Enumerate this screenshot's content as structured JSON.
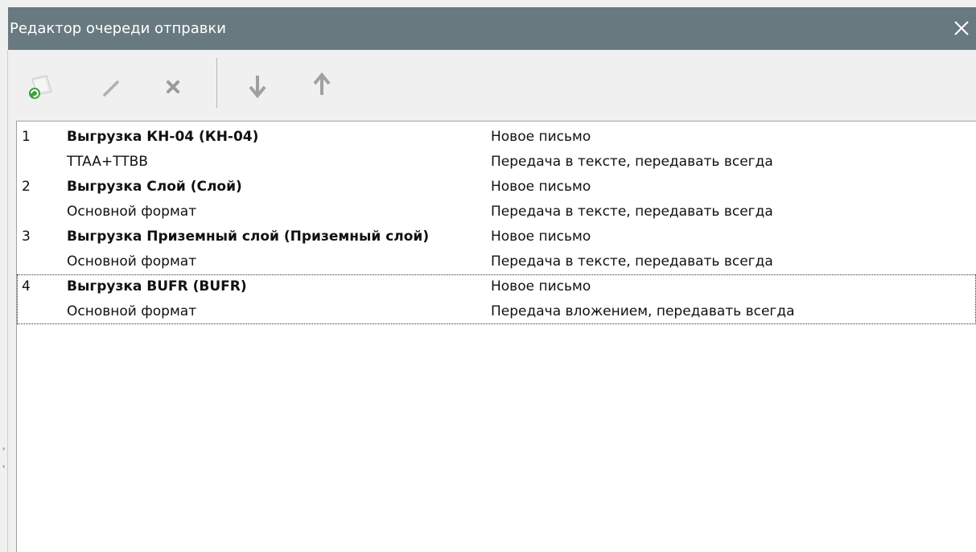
{
  "window": {
    "title": "Редактор очереди отправки",
    "titlebar_color": "#687a80"
  },
  "toolbar": {
    "buttons": [
      {
        "name": "add-button",
        "icon": "add-document-icon",
        "label": ""
      },
      {
        "name": "edit-button",
        "icon": "pencil-icon",
        "label": ""
      },
      {
        "name": "delete-button",
        "icon": "x-icon",
        "label": ""
      },
      {
        "name": "move-down-button",
        "icon": "arrow-down-icon",
        "label": ""
      },
      {
        "name": "move-up-button",
        "icon": "arrow-up-icon",
        "label": ""
      }
    ]
  },
  "queue": {
    "items": [
      {
        "num": "1",
        "name": "Выгрузка КН-04 (КН-04)",
        "format": "TTAA+TTBB",
        "letter": "Новое письмо",
        "transfer": "Передача в тексте, передавать всегда"
      },
      {
        "num": "2",
        "name": "Выгрузка Слой (Слой)",
        "format": "Основной формат",
        "letter": "Новое письмо",
        "transfer": "Передача в тексте, передавать всегда"
      },
      {
        "num": "3",
        "name": "Выгрузка Приземный слой (Приземный слой)",
        "format": "Основной формат",
        "letter": "Новое письмо",
        "transfer": "Передача в тексте, передавать всегда"
      },
      {
        "num": "4",
        "name": "Выгрузка BUFR (BUFR)",
        "format": "Основной формат",
        "letter": "Новое письмо",
        "transfer": "Передача вложением, передавать всегда"
      }
    ],
    "focused_index": 3
  }
}
